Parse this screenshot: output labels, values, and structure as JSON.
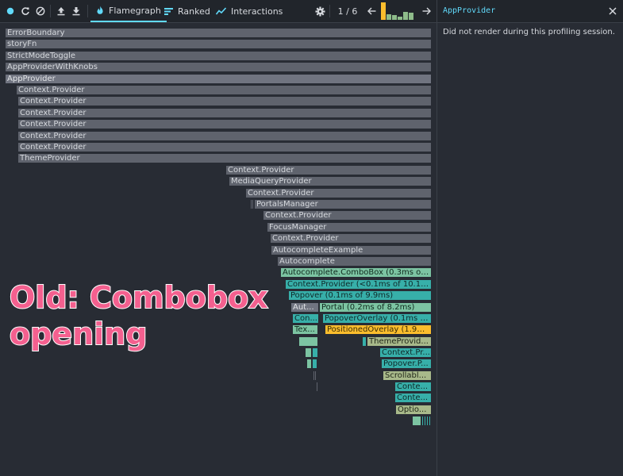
{
  "toolbar": {
    "record_icon": "record-icon",
    "reload_icon": "reload-icon",
    "clear_icon": "clear-icon",
    "load_icon": "upload-icon",
    "save_icon": "download-icon",
    "tabs": [
      {
        "label": "Flamegraph",
        "icon": "flame-icon",
        "active": true
      },
      {
        "label": "Ranked",
        "icon": "ranked-icon",
        "active": false
      },
      {
        "label": "Interactions",
        "icon": "interactions-icon",
        "active": false
      }
    ],
    "settings_icon": "gear-icon",
    "commit_counter": "1 / 6",
    "commit_bars": [
      1.0,
      0.3,
      0.25,
      0.2,
      0.45,
      0.4
    ],
    "selected_commit_index": 0
  },
  "flamegraph": {
    "nodes": [
      {
        "label": "ErrorBoundary",
        "color": "gray"
      },
      {
        "label": "storyFn",
        "color": "gray"
      },
      {
        "label": "StrictModeToggle",
        "color": "gray"
      },
      {
        "label": "AppProviderWithKnobs",
        "color": "gray"
      },
      {
        "label": "AppProvider",
        "color": "gray2"
      },
      {
        "label": "Context.Provider",
        "color": "gray"
      },
      {
        "label": "Context.Provider",
        "color": "gray"
      },
      {
        "label": "Context.Provider",
        "color": "gray"
      },
      {
        "label": "Context.Provider",
        "color": "gray"
      },
      {
        "label": "Context.Provider",
        "color": "gray"
      },
      {
        "label": "Context.Provider",
        "color": "gray"
      },
      {
        "label": "ThemeProvider",
        "color": "gray"
      },
      {
        "label": "Context.Provider",
        "color": "gray"
      },
      {
        "label": "MediaQueryProvider",
        "color": "gray"
      },
      {
        "label": "Context.Provider",
        "color": "gray"
      },
      {
        "label": "PortalsManager",
        "color": "gray"
      },
      {
        "label": "Context.Provider",
        "color": "gray"
      },
      {
        "label": "FocusManager",
        "color": "gray"
      },
      {
        "label": "Context.Provider",
        "color": "gray"
      },
      {
        "label": "AutocompleteExample",
        "color": "gray"
      },
      {
        "label": "Autocomplete",
        "color": "gray"
      },
      {
        "label": "Autocomplete.ComboBox (0.3ms of 1...",
        "color": "green"
      },
      {
        "label": "Context.Provider (<0.1ms of 10.1ms)",
        "color": "teal"
      },
      {
        "label": "Popover (0.1ms of 9.9ms)",
        "color": "teal"
      },
      {
        "label": "Aut...",
        "color": "gray2"
      },
      {
        "label": "Portal (0.2ms of 8.2ms)",
        "color": "green"
      },
      {
        "label": "Con...",
        "color": "teal"
      },
      {
        "label": "PopoverOverlay (0.1ms of ...",
        "color": "teal"
      },
      {
        "label": "Tex...",
        "color": "green"
      },
      {
        "label": "PositionedOverlay (1.9ms...",
        "color": "yellow"
      },
      {
        "label": "ThemeProvid...",
        "color": "olive"
      },
      {
        "label": "Context.Pr...",
        "color": "teal"
      },
      {
        "label": "Popover.P...",
        "color": "teal"
      },
      {
        "label": "Scrollabl...",
        "color": "olive"
      },
      {
        "label": "Conte...",
        "color": "teal"
      },
      {
        "label": "Conte...",
        "color": "teal"
      },
      {
        "label": "Optio...",
        "color": "olive"
      }
    ]
  },
  "sidebar": {
    "title": "AppProvider",
    "close_icon": "close-icon",
    "message": "Did not render during this profiling session."
  },
  "overlay": {
    "line1": "Old: Combobox",
    "line2": "opening"
  }
}
